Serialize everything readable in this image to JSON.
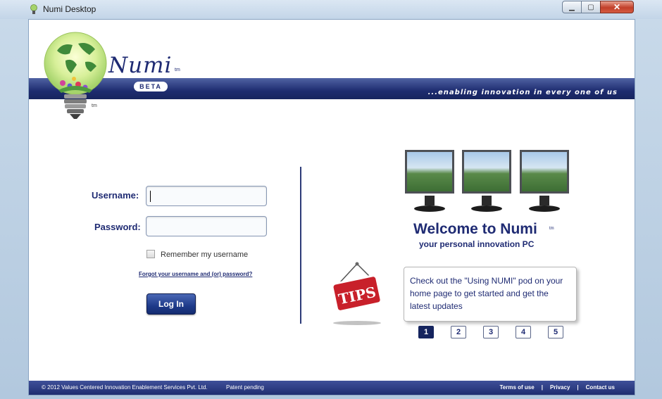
{
  "window": {
    "title": "Numi Desktop",
    "minimize_glyph": "▁",
    "maximize_glyph": "▢",
    "close_glyph": "✕"
  },
  "header": {
    "logo_text": "Numi",
    "logo_tm": "tm",
    "beta_label": "BETA",
    "bulb_tm": "tm",
    "tagline": "...enabling innovation in every one of us"
  },
  "login": {
    "username_label": "Username:",
    "username_value": "",
    "password_label": "Password:",
    "password_value": "",
    "remember_label": "Remember my username",
    "remember_checked": false,
    "forgot_link": "Forgot your username and (or) password?",
    "login_button": "Log In"
  },
  "welcome": {
    "title": "Welcome to Numi",
    "title_tm": "tm",
    "subtitle": "your personal innovation PC",
    "tips_label": "TIPS",
    "tip_text": "Check out the \"Using NUMI\" pod on your home page to get started and get the latest updates",
    "pages": [
      "1",
      "2",
      "3",
      "4",
      "5"
    ],
    "active_page": "1"
  },
  "footer": {
    "copyright": "© 2012 Values Centered Innovation Enablement Services Pvt. Ltd.",
    "patent": "Patent pending",
    "links": [
      "Terms of use",
      "Privacy",
      "Contact us"
    ],
    "separator": "|"
  },
  "colors": {
    "brand_navy": "#1f2b73",
    "banner": "#1e2c70",
    "tips_red": "#c8202a"
  }
}
